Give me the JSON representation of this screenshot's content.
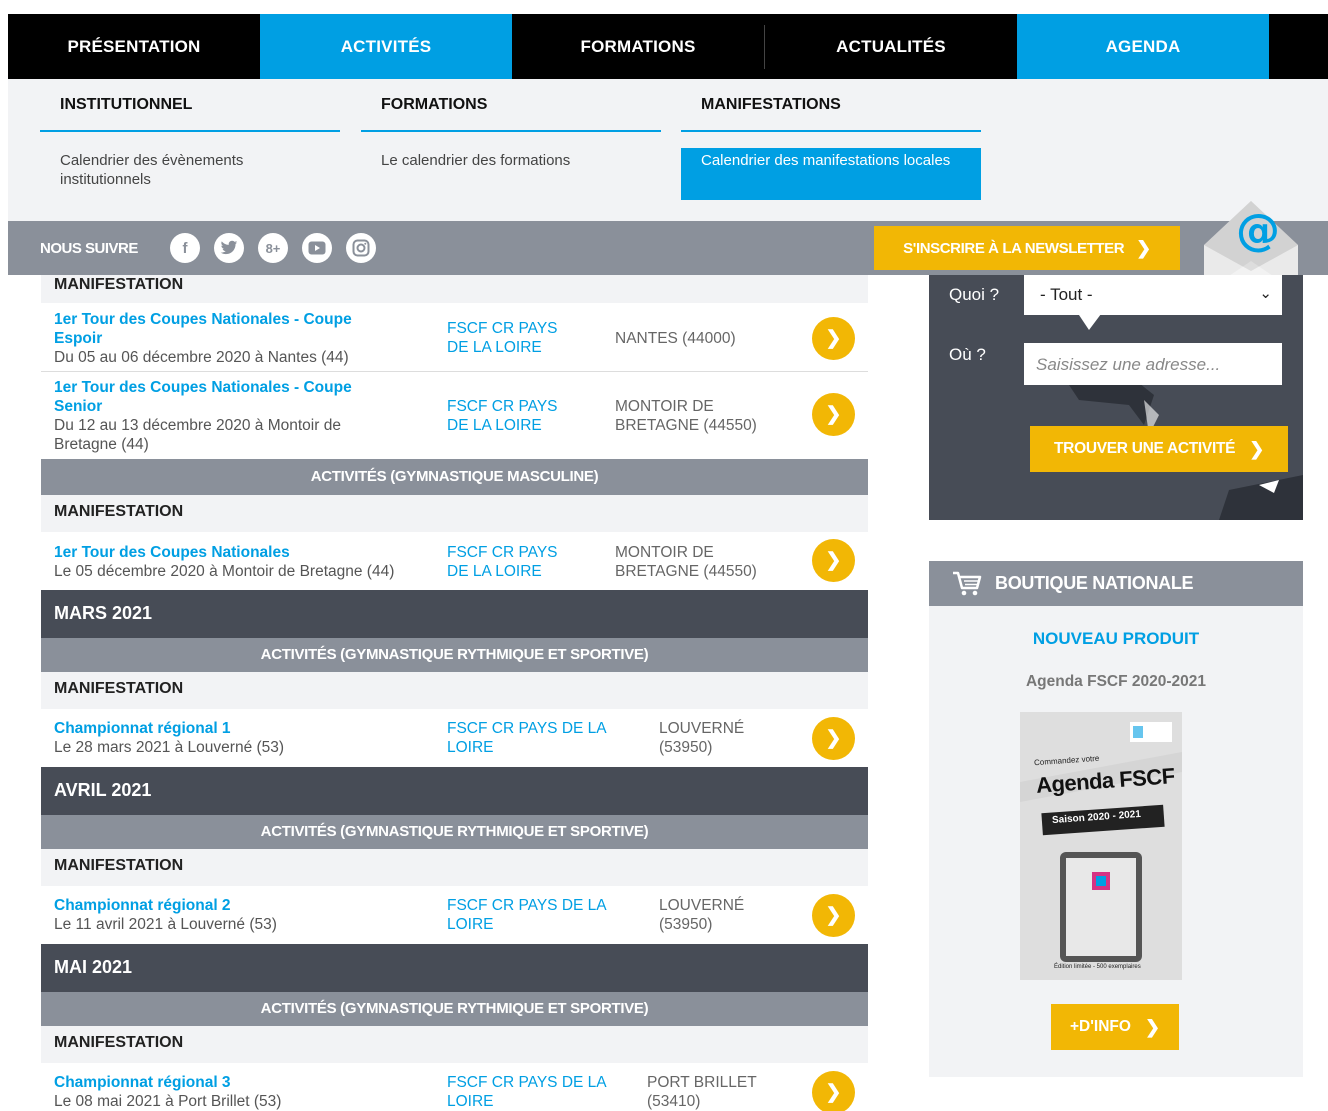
{
  "nav": {
    "items": [
      {
        "label": "PRÉSENTATION",
        "active": false
      },
      {
        "label": "ACTIVITÉS",
        "active": true
      },
      {
        "label": "FORMATIONS",
        "active": false
      },
      {
        "label": "ACTUALITÉS",
        "active": false
      },
      {
        "label": "AGENDA",
        "active": true
      }
    ]
  },
  "dropdown": {
    "columns": [
      {
        "heading": "INSTITUTIONNEL",
        "link": "Calendrier des évènements institutionnels",
        "active": false
      },
      {
        "heading": "FORMATIONS",
        "link": "Le calendrier des formations",
        "active": false
      },
      {
        "heading": "MANIFESTATIONS",
        "link": "Calendrier des manifestations locales",
        "active": true
      }
    ]
  },
  "social": {
    "follow_label": "NOUS SUIVRE",
    "icons": [
      "facebook-icon",
      "twitter-icon",
      "google-plus-icon",
      "youtube-icon",
      "instagram-icon"
    ],
    "newsletter_label": "S'INSCRIRE À LA NEWSLETTER"
  },
  "listing": {
    "manif_label": "MANIFESTATION",
    "events_block1": [
      {
        "title": "1er Tour des Coupes Nationales - Coupe Espoir",
        "date": "Du 05 au 06 décembre 2020 à Nantes (44)",
        "org": "FSCF CR PAYS DE LA LOIRE",
        "place": "NANTES (44000)"
      },
      {
        "title": "1er Tour des Coupes Nationales - Coupe Senior",
        "date": "Du 12 au 13 décembre 2020 à Montoir de Bretagne (44)",
        "org": "FSCF CR PAYS DE LA LOIRE",
        "place": "MONTOIR DE BRETAGNE (44550)"
      }
    ],
    "cat_masc": "ACTIVITÉS (GYMNASTIQUE MASCULINE)",
    "event_masc": {
      "title": "1er Tour des Coupes Nationales",
      "date": "Le 05 décembre 2020 à Montoir de Bretagne (44)",
      "org": "FSCF CR PAYS DE LA LOIRE",
      "place": "MONTOIR DE BRETAGNE (44550)"
    },
    "cat_grs": "ACTIVITÉS (GYMNASTIQUE RYTHMIQUE ET SPORTIVE)",
    "months": [
      {
        "name": "MARS 2021",
        "event": {
          "title": "Championnat régional 1",
          "date": "Le 28 mars 2021 à Louverné (53)",
          "org": "FSCF CR PAYS DE LA LOIRE",
          "place": "LOUVERNÉ (53950)"
        }
      },
      {
        "name": "AVRIL 2021",
        "event": {
          "title": "Championnat régional 2",
          "date": "Le 11 avril 2021 à Louverné (53)",
          "org": "FSCF CR PAYS DE LA LOIRE",
          "place": "LOUVERNÉ (53950)"
        }
      },
      {
        "name": "MAI 2021",
        "event": {
          "title": "Championnat régional 3",
          "date": "Le 08 mai 2021 à Port Brillet (53)",
          "org": "FSCF CR PAYS DE LA LOIRE",
          "place": "PORT BRILLET (53410)"
        }
      }
    ]
  },
  "finder": {
    "quoi_label": "Quoi ?",
    "quoi_value": "- Tout -",
    "ou_label": "Où ?",
    "address_placeholder": "Saisissez une adresse...",
    "button_label": "TROUVER UNE ACTIVITÉ"
  },
  "shop": {
    "heading": "BOUTIQUE NATIONALE",
    "new_label": "NOUVEAU PRODUIT",
    "product_name": "Agenda FSCF 2020-2021",
    "poster": {
      "line1": "Commandez votre",
      "title": "Agenda FSCF",
      "season": "Saison 2020 - 2021",
      "edition": "Édition limitée - 500 exemplaires"
    },
    "more_label": "+D'INFO"
  },
  "colors": {
    "accent_blue": "#009fe3",
    "accent_yellow": "#f2b705",
    "dark": "#474c56",
    "grey": "#8a909a"
  }
}
